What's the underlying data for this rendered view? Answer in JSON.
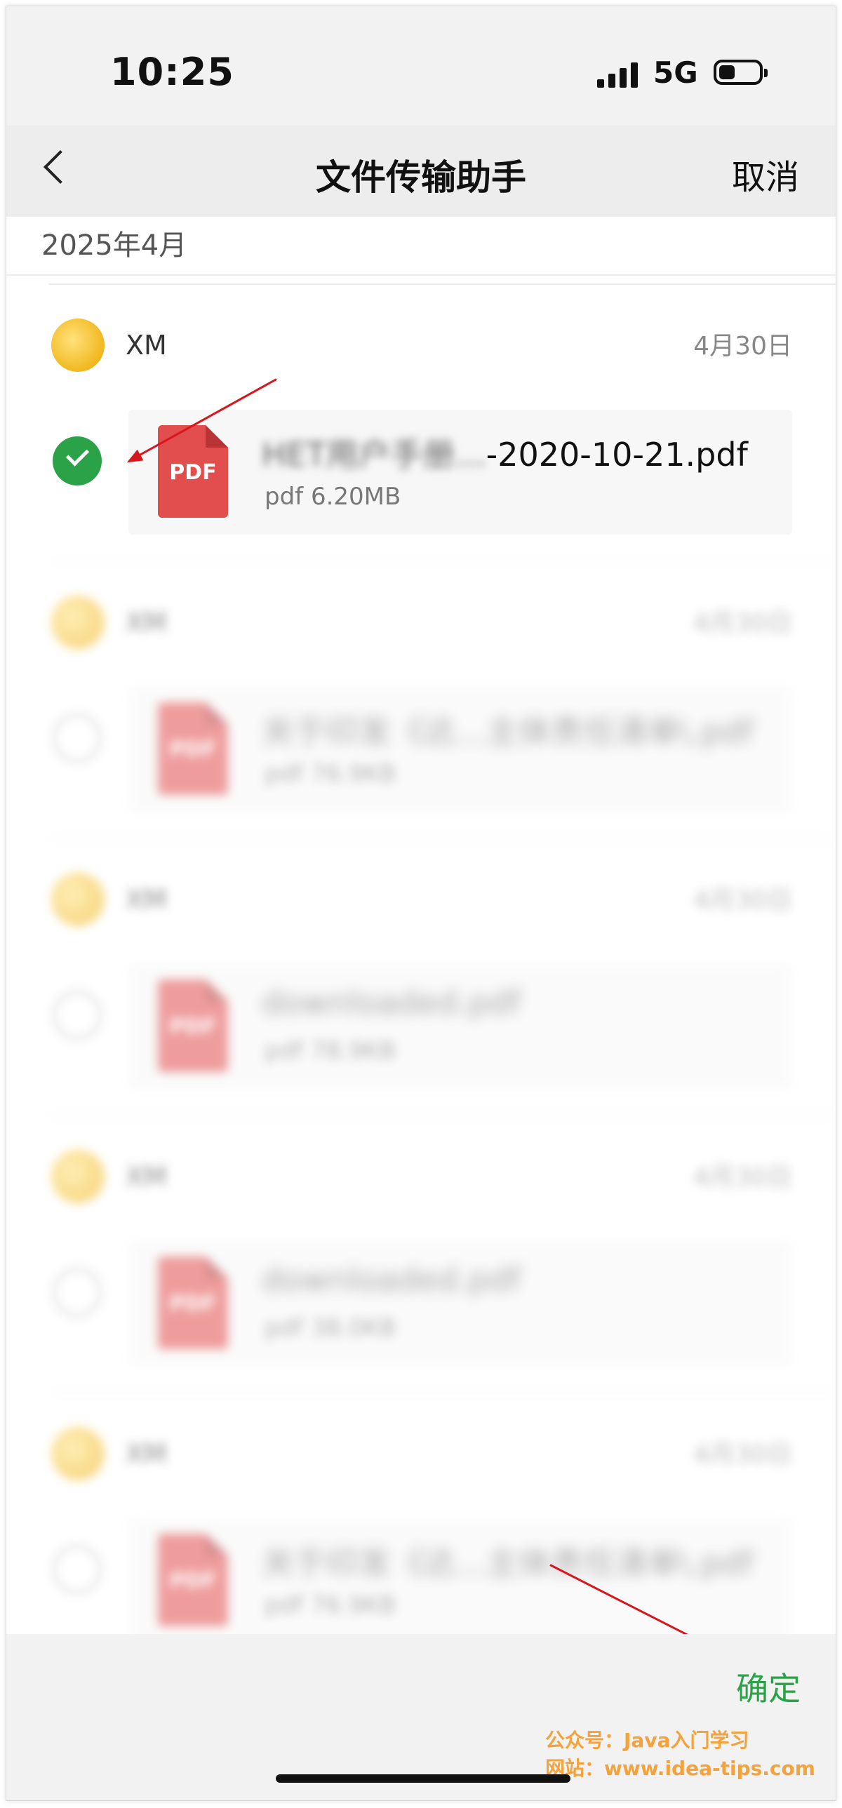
{
  "status_bar": {
    "time": "10:25",
    "network": "5G",
    "battery_level_percent": 40
  },
  "nav": {
    "title": "文件传输助手",
    "cancel_label": "取消",
    "back_icon": "chevron-left-icon"
  },
  "month_header": "2025年4月",
  "messages": [
    {
      "sender": "XM",
      "date": "4月30日",
      "selected": true,
      "file_name_visible": "-2020-10-21.pdf",
      "file_name_blurred": "HET用户手册...",
      "file_meta": "pdf 6.20MB",
      "file_icon": "PDF"
    },
    {
      "sender": "XM",
      "date": "4月30日",
      "selected": false,
      "file_name_visible": "",
      "file_name_blurred": "关于印发《达...主体责任清单\\.pdf",
      "file_meta": "pdf 76.9KB",
      "file_icon": "PDF"
    },
    {
      "sender": "XM",
      "date": "4月30日",
      "selected": false,
      "file_name_visible": "",
      "file_name_blurred": "downloaded.pdf",
      "file_meta": "pdf 78.9KB",
      "file_icon": "PDF"
    },
    {
      "sender": "XM",
      "date": "4月30日",
      "selected": false,
      "file_name_visible": "",
      "file_name_blurred": "downloaded.pdf",
      "file_meta": "pdf 38.0KB",
      "file_icon": "PDF"
    },
    {
      "sender": "XM",
      "date": "4月30日",
      "selected": false,
      "file_name_visible": "",
      "file_name_blurred": "关于印发《达...主体责任清单\\.pdf",
      "file_meta": "pdf 76.9KB",
      "file_icon": "PDF"
    }
  ],
  "footer": {
    "confirm_label": "确定"
  },
  "watermark": {
    "line1": "公众号：Java入门学习",
    "line2": "网站：www.idea-tips.com"
  },
  "colors": {
    "accent_green": "#2ba248",
    "annotation_red": "#d8161e",
    "pdf_red": "#e24d4d",
    "watermark_orange": "#f4a23b"
  }
}
